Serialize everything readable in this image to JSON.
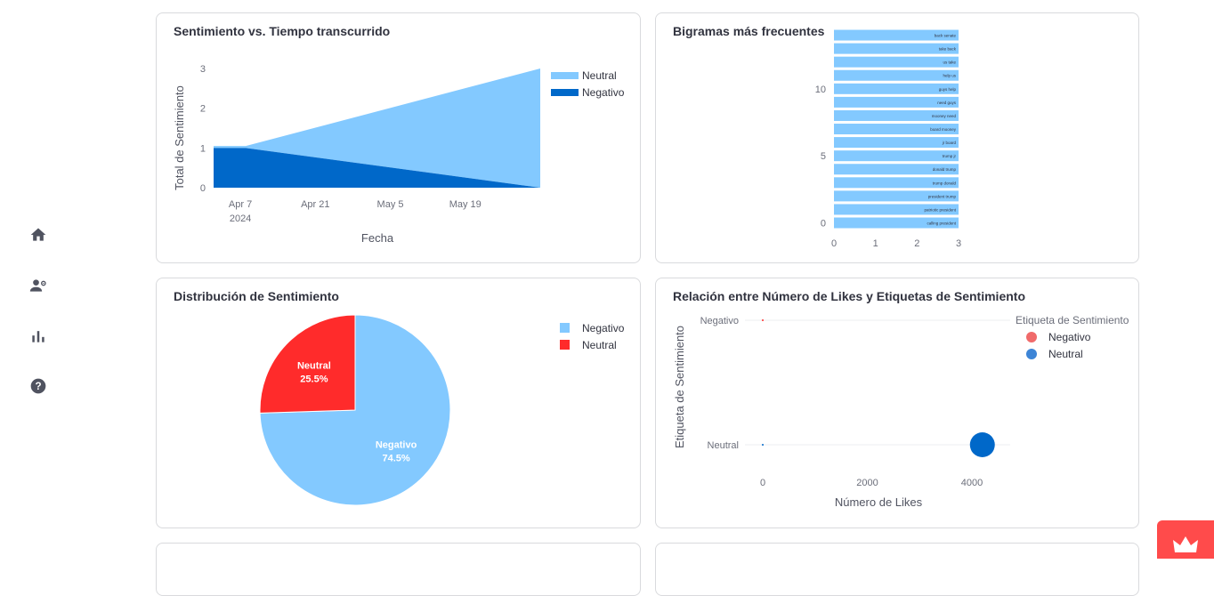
{
  "sidebar": {
    "items": [
      {
        "icon": "home-icon"
      },
      {
        "icon": "user-settings-icon"
      },
      {
        "icon": "bar-chart-icon"
      },
      {
        "icon": "help-icon"
      }
    ]
  },
  "colors": {
    "light_blue": "#83c9ff",
    "dark_blue": "#0068c9",
    "red": "#ff2b2b",
    "pink": "#f06a6a",
    "mid_blue": "#3d85d6",
    "accent": "#ff4b4b"
  },
  "cards": {
    "area": {
      "title": "Sentimiento vs. Tiempo transcurrido"
    },
    "bigrams": {
      "title": "Bigramas más frecuentes"
    },
    "pie": {
      "title": "Distribución de Sentimiento"
    },
    "scatter": {
      "title": "Relación entre Número de Likes y Etiquetas de Sentimiento"
    }
  },
  "chart_data": [
    {
      "type": "area",
      "title": "Sentimiento vs. Tiempo transcurrido",
      "xlabel": "Fecha",
      "ylabel": "Total de Sentimiento",
      "x_tick_labels": [
        "Apr 7",
        "Apr 21",
        "May 5",
        "May 19"
      ],
      "x_tick_sublabel": "2024",
      "x": [
        "2024-04-01",
        "2024-04-07",
        "2024-06-01"
      ],
      "series": [
        {
          "name": "Negativo",
          "values": [
            1,
            1,
            0
          ]
        },
        {
          "name": "Neutral",
          "values": [
            0.05,
            0.05,
            3
          ]
        }
      ],
      "stacked": true,
      "ylim": [
        0,
        3
      ],
      "y_ticks": [
        0,
        1,
        2,
        3
      ],
      "legend": "top-right"
    },
    {
      "type": "bar",
      "orientation": "horizontal",
      "title": "Bigramas más frecuentes",
      "categories": [
        "calling president",
        "patriotic president",
        "president trump",
        "trump donald",
        "donald trump",
        "trump jr",
        "jr board",
        "board mooney",
        "mooney need",
        "need guys",
        "guys help",
        "help us",
        "us take",
        "take back",
        "back senate"
      ],
      "values": [
        3,
        3,
        3,
        3,
        3,
        3,
        3,
        3,
        3,
        3,
        3,
        3,
        3,
        3,
        3
      ],
      "x_ticks": [
        0,
        1,
        2,
        3
      ],
      "y_ticks": [
        0,
        5,
        10
      ],
      "xlim": [
        0,
        3
      ]
    },
    {
      "type": "pie",
      "title": "Distribución de Sentimiento",
      "slices": [
        {
          "label": "Negativo",
          "value": 74.5,
          "display": "74.5%"
        },
        {
          "label": "Neutral",
          "value": 25.5,
          "display": "25.5%"
        }
      ],
      "legend": "top-right"
    },
    {
      "type": "scatter",
      "title": "Relación entre Número de Likes y Etiquetas de Sentimiento",
      "xlabel": "Número de Likes",
      "ylabel": "Etiqueta de Sentimiento",
      "y_categories": [
        "Neutral",
        "Negativo"
      ],
      "x_ticks": [
        0,
        2000,
        4000
      ],
      "legend_title": "Etiqueta de Sentimiento",
      "series": [
        {
          "name": "Negativo",
          "points": [
            {
              "x": 0,
              "y": "Negativo",
              "size": 1
            }
          ]
        },
        {
          "name": "Neutral",
          "points": [
            {
              "x": 0,
              "y": "Neutral",
              "size": 1
            },
            {
              "x": 4200,
              "y": "Neutral",
              "size": 28
            }
          ]
        }
      ],
      "legend": "top-right"
    }
  ]
}
